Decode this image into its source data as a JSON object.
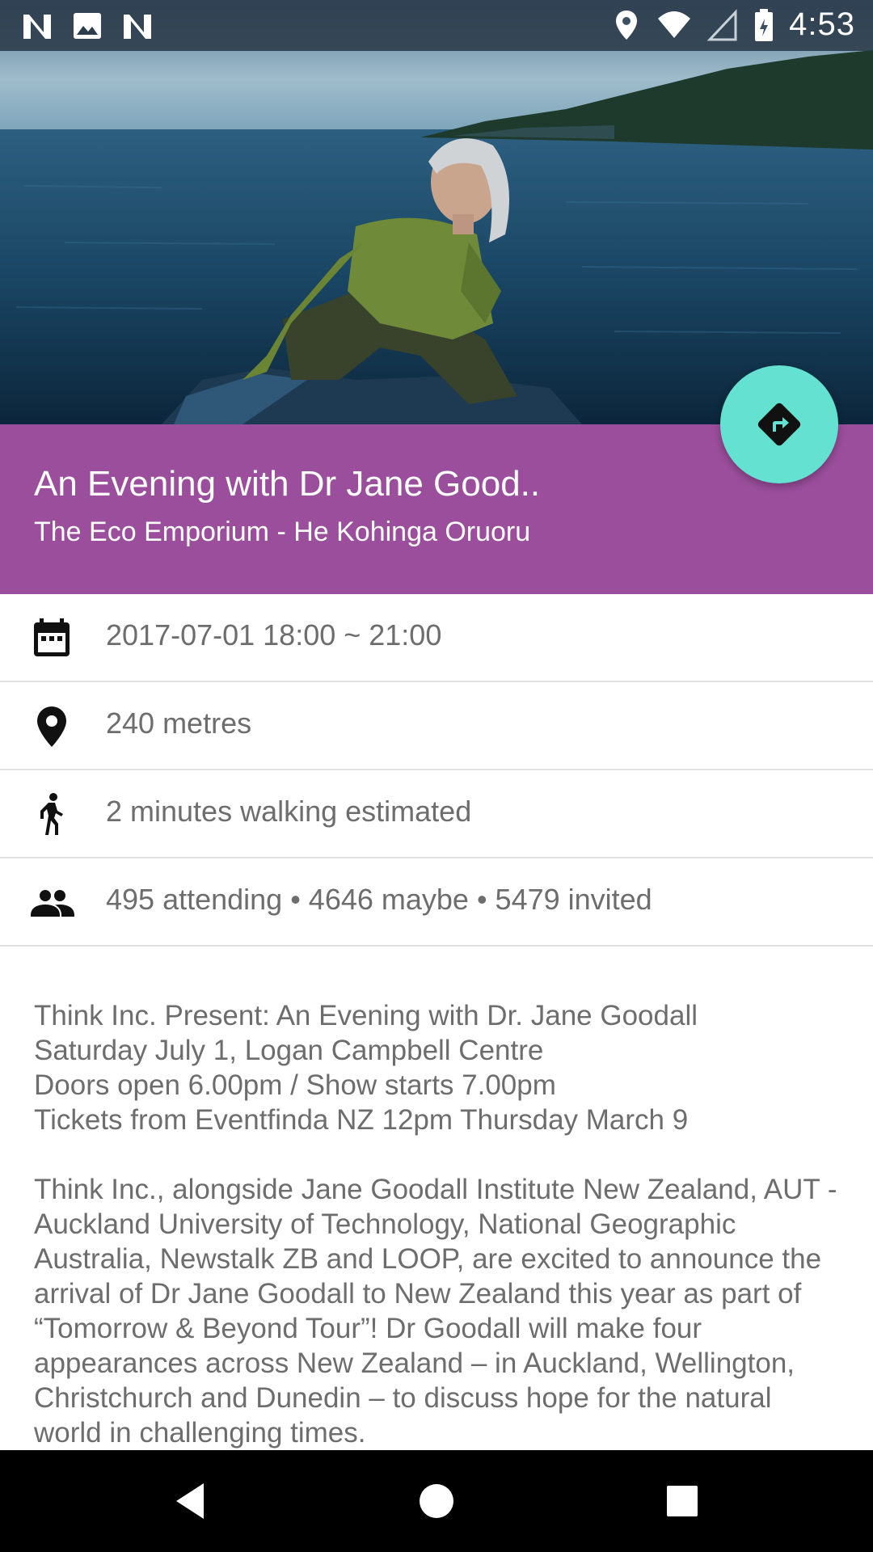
{
  "status_bar": {
    "time": "4:53",
    "left_icons": [
      "n-notification-icon",
      "image-notification-icon",
      "n-notification-icon"
    ],
    "right_icons": [
      "location-icon",
      "wifi-icon",
      "signal-icon",
      "battery-icon"
    ]
  },
  "hero": {
    "image": "photo-jane-goodall-boat"
  },
  "event": {
    "title": "An Evening with Dr Jane Good..",
    "venue": "The Eco Emporium - He Kohinga Oruoru"
  },
  "fab": {
    "icon": "directions-icon"
  },
  "info_rows": [
    {
      "icon": "calendar-icon",
      "text": "2017-07-01 18:00 ~ 21:00"
    },
    {
      "icon": "location-pin-icon",
      "text": "240 metres"
    },
    {
      "icon": "walking-icon",
      "text": "2 minutes walking estimated"
    },
    {
      "icon": "people-icon",
      "text": "495 attending • 4646 maybe • 5479 invited"
    }
  ],
  "description": {
    "paragraphs": [
      "Think Inc. Present: An Evening with Dr. Jane Goodall\nSaturday July 1, Logan Campbell Centre\nDoors open 6.00pm / Show starts 7.00pm\nTickets from Eventfinda NZ 12pm Thursday March 9",
      "Think Inc., alongside Jane Goodall Institute New Zealand, AUT - Auckland University of Technology, National Geographic Australia, Newstalk ZB and LOOP, are excited to announce the arrival of Dr Jane Goodall to New Zealand this year as part of “Tomorrow & Beyond Tour”! Dr Goodall will make four appearances across New Zealand – in Auckland, Wellington, Christchurch and Dunedin – to discuss hope for the natural world in challenging times."
    ]
  },
  "nav_bar": {
    "buttons": [
      "back-icon",
      "home-icon",
      "recents-icon"
    ]
  },
  "colors": {
    "accent_purple": "#9b4e9c",
    "fab_teal": "#64e1d0",
    "text_gray": "#6d6d6d"
  }
}
